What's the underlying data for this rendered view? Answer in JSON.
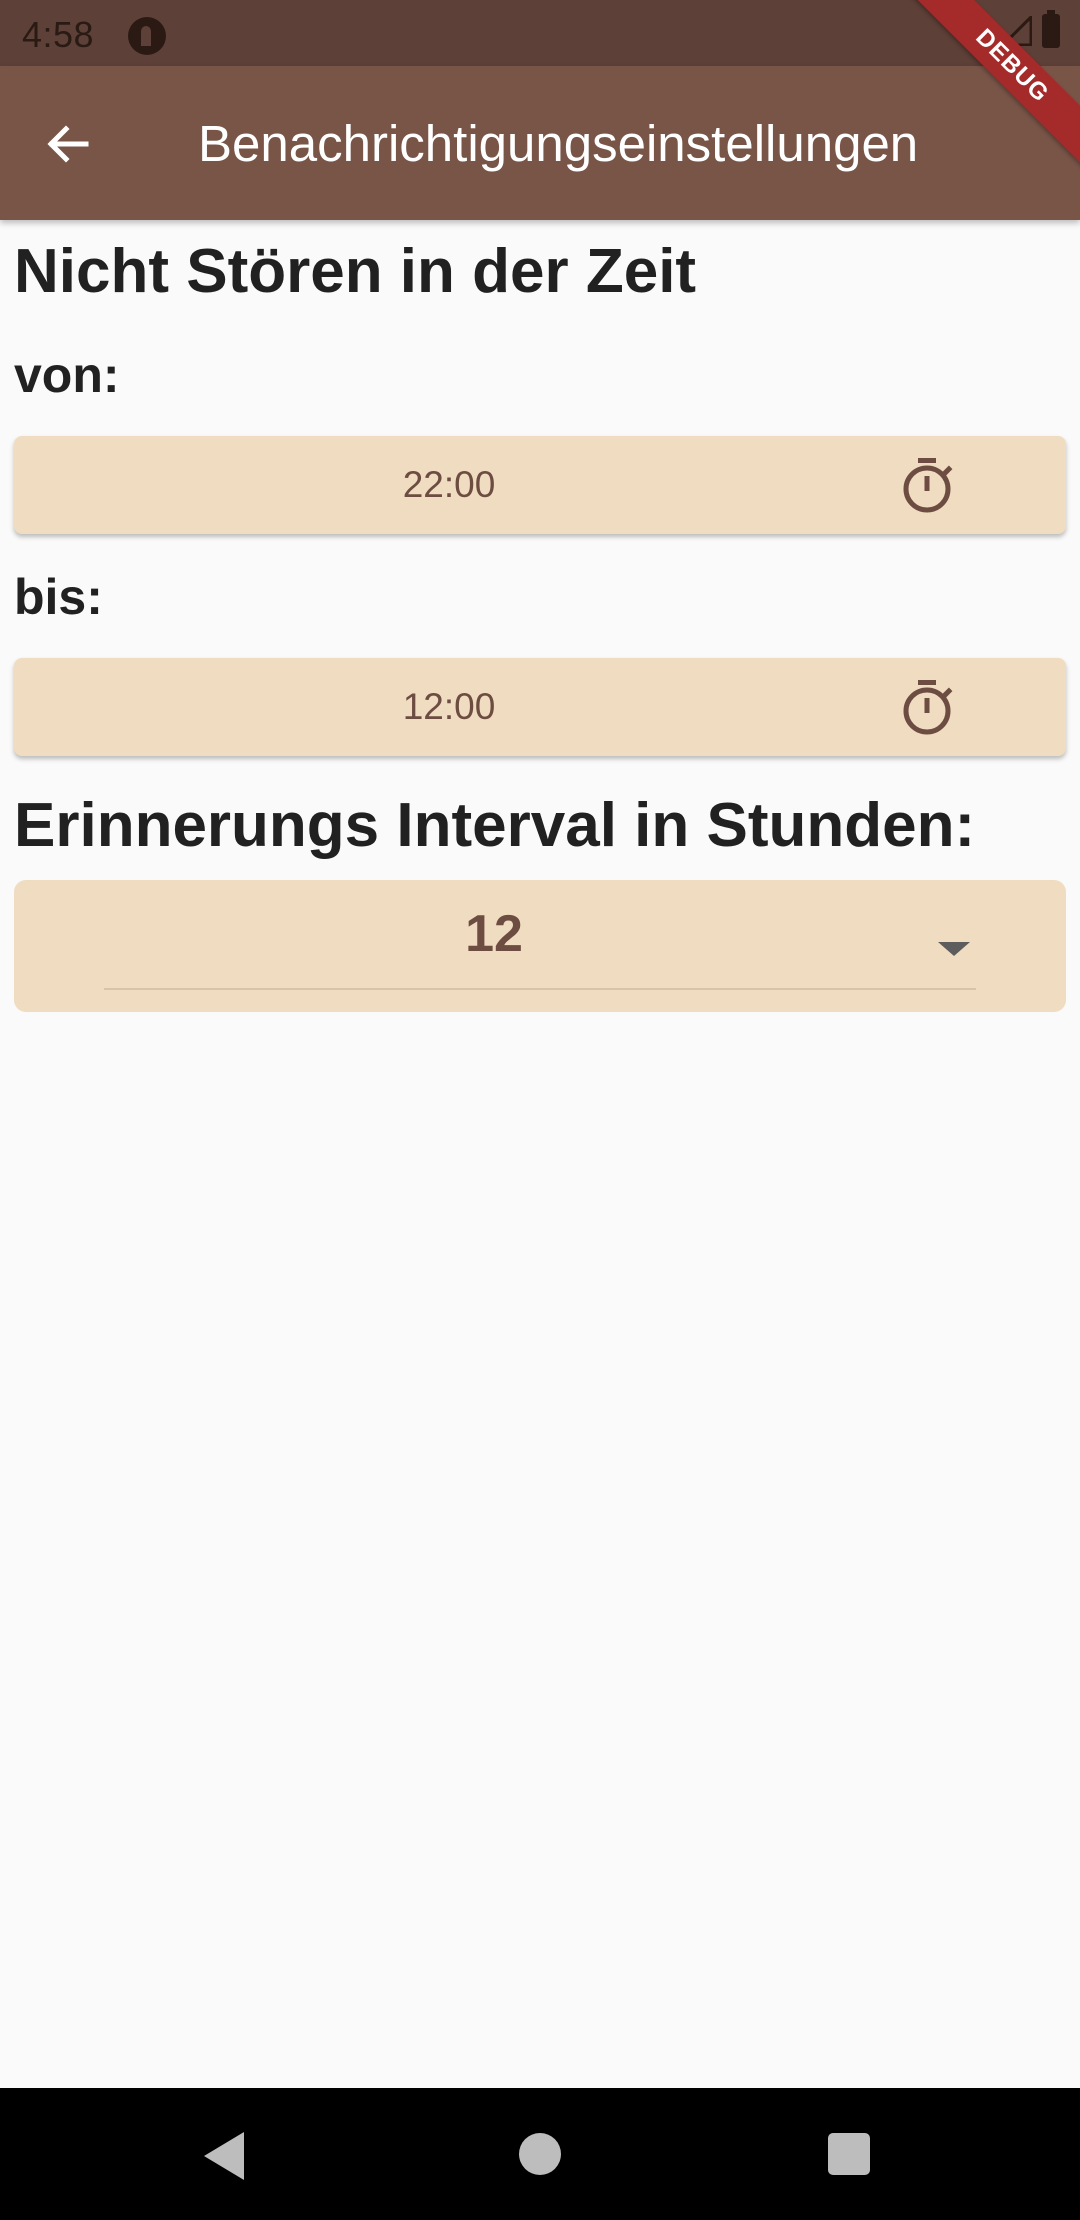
{
  "status_bar": {
    "time": "4:58"
  },
  "app_bar": {
    "title": "Benachrichtigungseinstellungen",
    "debug_banner": "DEBUG"
  },
  "dnd": {
    "title": "Nicht Stören in der Zeit",
    "from_label": "von:",
    "from_value": "22:00",
    "to_label": "bis:",
    "to_value": "12:00"
  },
  "interval": {
    "title": "Erinnerungs Interval in Stunden:",
    "selected_value": "12"
  },
  "colors": {
    "app_bar": "#795548",
    "status_bar": "#5d4037",
    "button_bg": "#f0dcc0",
    "accent_text": "#6d4c41",
    "debug_banner": "#a52a2a"
  },
  "icons": [
    "back-arrow-icon",
    "timer-icon",
    "dropdown-arrow-icon",
    "wifi-icon",
    "signal-icon",
    "battery-icon"
  ]
}
